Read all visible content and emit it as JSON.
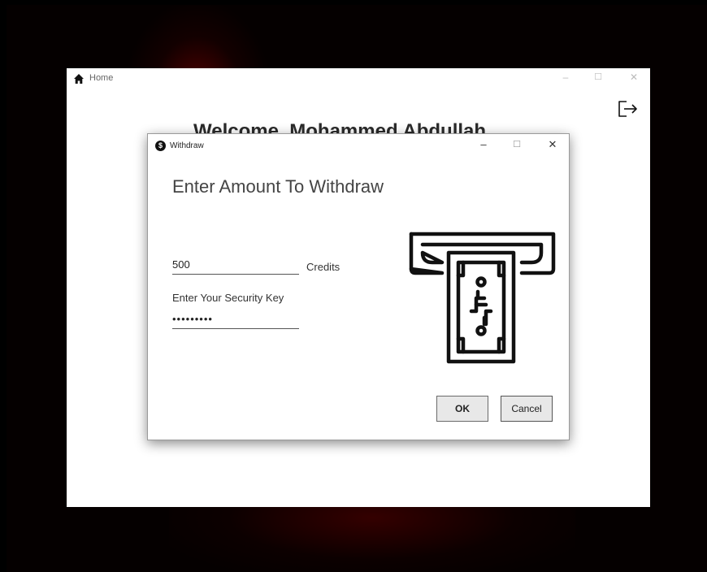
{
  "home_window": {
    "title": "Home",
    "heading": "Welcome, Mohammed Abdullah",
    "controls": {
      "minimize": "–",
      "maximize": "☐",
      "close": "✕"
    }
  },
  "dialog": {
    "title": "Withdraw",
    "icon_text": "$",
    "heading": "Enter Amount To Withdraw",
    "amount_value": "500",
    "credits_label": "Credits",
    "security_label": "Enter Your Security Key",
    "security_value": "123456789",
    "ok_label": "OK",
    "cancel_label": "Cancel",
    "controls": {
      "minimize": "–",
      "maximize": "☐",
      "close": "✕"
    }
  },
  "icons": {
    "home": "home-icon",
    "logout": "logout-icon",
    "dialog_app": "dollar-circle-icon",
    "illustration": "atm-cash-withdraw-icon"
  },
  "colors": {
    "window_bg": "#ffffff",
    "screen_bg": "#000000",
    "button_bg": "#e8e8e8",
    "text": "#444444"
  }
}
